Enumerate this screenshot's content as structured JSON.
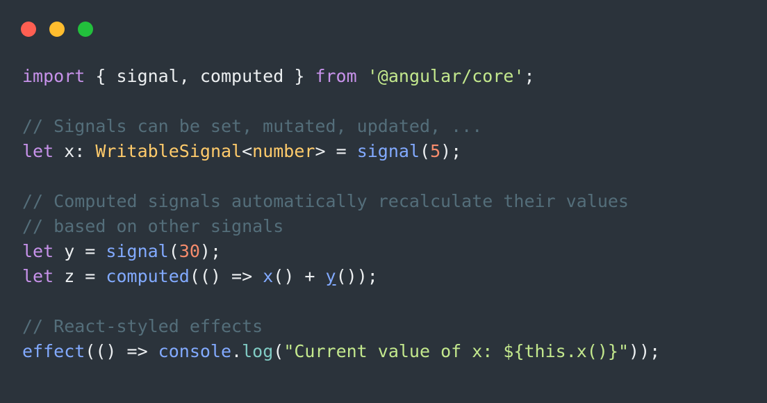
{
  "window": {
    "title": "",
    "background_color": "#2b333b",
    "controls": [
      {
        "name": "close",
        "label": "",
        "color": "#ff5f52"
      },
      {
        "name": "minimize",
        "label": "",
        "color": "#ffbd2e"
      },
      {
        "name": "maximize",
        "label": "",
        "color": "#22c03c"
      }
    ]
  },
  "theme": {
    "background": "#2b333b",
    "foreground": "#eceff1",
    "keyword": "#c792ea",
    "string": "#c3e88d",
    "comment": "#546e7a",
    "type": "#ffcb6b",
    "function": "#82aaff",
    "number": "#f78c6c",
    "method": "#80cbc4"
  },
  "code": {
    "language": "typescript",
    "lines": [
      {
        "index": 1,
        "text": "import { signal, computed } from '@angular/core';",
        "tokens": [
          {
            "t": "import",
            "c": "keyword"
          },
          {
            "t": " { signal, computed } ",
            "c": "plain"
          },
          {
            "t": "from",
            "c": "keyword"
          },
          {
            "t": " ",
            "c": "plain"
          },
          {
            "t": "'@angular/core'",
            "c": "string"
          },
          {
            "t": ";",
            "c": "plain"
          }
        ]
      },
      {
        "index": 2,
        "text": "",
        "tokens": []
      },
      {
        "index": 3,
        "text": "// Signals can be set, mutated, updated, ...",
        "tokens": [
          {
            "t": "// Signals can be set, mutated, updated, ...",
            "c": "comment"
          }
        ]
      },
      {
        "index": 4,
        "text": "let x: WritableSignal<number> = signal(5);",
        "tokens": [
          {
            "t": "let",
            "c": "keyword"
          },
          {
            "t": " x: ",
            "c": "plain"
          },
          {
            "t": "WritableSignal",
            "c": "type"
          },
          {
            "t": "<",
            "c": "plain"
          },
          {
            "t": "number",
            "c": "type"
          },
          {
            "t": "> = ",
            "c": "plain"
          },
          {
            "t": "signal",
            "c": "func"
          },
          {
            "t": "(",
            "c": "plain"
          },
          {
            "t": "5",
            "c": "number"
          },
          {
            "t": ");",
            "c": "plain"
          }
        ]
      },
      {
        "index": 5,
        "text": "",
        "tokens": []
      },
      {
        "index": 6,
        "text": "// Computed signals automatically recalculate their values",
        "tokens": [
          {
            "t": "// Computed signals automatically recalculate their values",
            "c": "comment"
          }
        ]
      },
      {
        "index": 7,
        "text": "// based on other signals",
        "tokens": [
          {
            "t": "// based on other signals",
            "c": "comment"
          }
        ]
      },
      {
        "index": 8,
        "text": "let y = signal(30);",
        "tokens": [
          {
            "t": "let",
            "c": "keyword"
          },
          {
            "t": " y = ",
            "c": "plain"
          },
          {
            "t": "signal",
            "c": "func"
          },
          {
            "t": "(",
            "c": "plain"
          },
          {
            "t": "30",
            "c": "number"
          },
          {
            "t": ");",
            "c": "plain"
          }
        ]
      },
      {
        "index": 9,
        "text": "let z = computed(() => x() + y());",
        "tokens": [
          {
            "t": "let",
            "c": "keyword"
          },
          {
            "t": " z = ",
            "c": "plain"
          },
          {
            "t": "computed",
            "c": "func"
          },
          {
            "t": "(() => ",
            "c": "plain"
          },
          {
            "t": "x",
            "c": "func"
          },
          {
            "t": "() + ",
            "c": "plain"
          },
          {
            "t": "y",
            "c": "link"
          },
          {
            "t": "());",
            "c": "plain"
          }
        ]
      },
      {
        "index": 10,
        "text": "",
        "tokens": []
      },
      {
        "index": 11,
        "text": "// React-styled effects",
        "tokens": [
          {
            "t": "// React-styled effects",
            "c": "comment"
          }
        ]
      },
      {
        "index": 12,
        "text": "effect(() => console.log(\"Current value of x: ${this.x()}\"));",
        "tokens": [
          {
            "t": "effect",
            "c": "func"
          },
          {
            "t": "(() => ",
            "c": "plain"
          },
          {
            "t": "console",
            "c": "func"
          },
          {
            "t": ".",
            "c": "plain"
          },
          {
            "t": "log",
            "c": "method"
          },
          {
            "t": "(",
            "c": "plain"
          },
          {
            "t": "\"Current value of x: ${this.x()}\"",
            "c": "string"
          },
          {
            "t": "));",
            "c": "plain"
          }
        ]
      }
    ]
  }
}
